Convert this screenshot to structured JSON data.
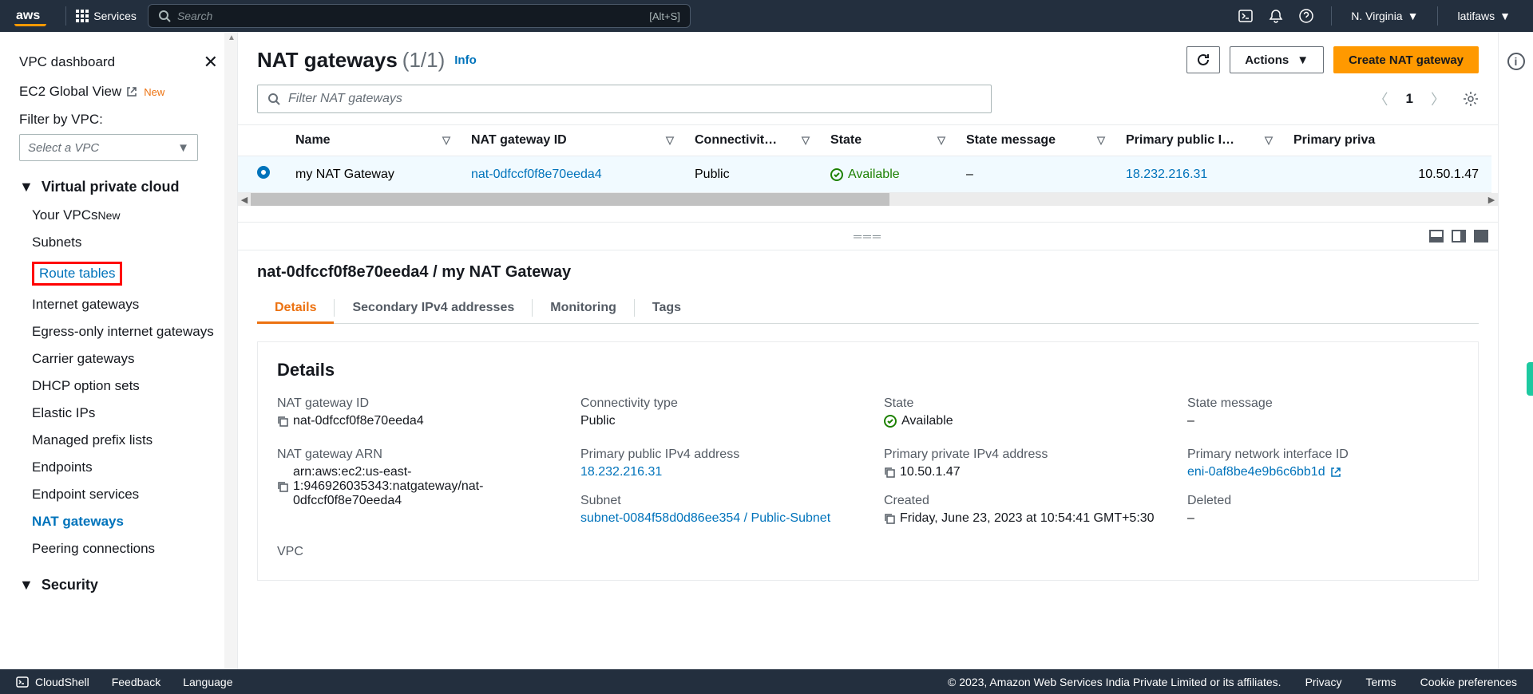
{
  "topnav": {
    "services": "Services",
    "search_placeholder": "Search",
    "search_shortcut": "[Alt+S]",
    "region": "N. Virginia",
    "user": "latifaws"
  },
  "sidebar": {
    "dashboard": "VPC dashboard",
    "global_view": "EC2 Global View",
    "badge_new": "New",
    "filter_label": "Filter by VPC:",
    "select_placeholder": "Select a VPC",
    "sections": {
      "vpc": {
        "title": "Virtual private cloud",
        "items": [
          "Your VPCs",
          "Subnets",
          "Route tables",
          "Internet gateways",
          "Egress-only internet gateways",
          "Carrier gateways",
          "DHCP option sets",
          "Elastic IPs",
          "Managed prefix lists",
          "Endpoints",
          "Endpoint services",
          "NAT gateways",
          "Peering connections"
        ]
      },
      "security": {
        "title": "Security"
      }
    }
  },
  "header": {
    "title": "NAT gateways",
    "count": "(1/1)",
    "info": "Info",
    "actions": "Actions",
    "create": "Create NAT gateway",
    "filter_placeholder": "Filter NAT gateways",
    "page": "1"
  },
  "table": {
    "cols": [
      "Name",
      "NAT gateway ID",
      "Connectivit…",
      "State",
      "State message",
      "Primary public I…",
      "Primary priva"
    ],
    "row": {
      "name": "my NAT Gateway",
      "id": "nat-0dfccf0f8e70eeda4",
      "connectivity": "Public",
      "state": "Available",
      "state_message": "–",
      "public_ip": "18.232.216.31",
      "private_ip": "10.50.1.47"
    }
  },
  "detail": {
    "breadcrumb": "nat-0dfccf0f8e70eeda4 / my NAT Gateway",
    "tabs": [
      "Details",
      "Secondary IPv4 addresses",
      "Monitoring",
      "Tags"
    ],
    "section_title": "Details",
    "fields": {
      "nat_id_label": "NAT gateway ID",
      "nat_id": "nat-0dfccf0f8e70eeda4",
      "conn_label": "Connectivity type",
      "conn": "Public",
      "state_label": "State",
      "state": "Available",
      "msg_label": "State message",
      "msg": "–",
      "arn_label": "NAT gateway ARN",
      "arn": "arn:aws:ec2:us-east-1:946926035343:natgateway/nat-0dfccf0f8e70eeda4",
      "pubip_label": "Primary public IPv4 address",
      "pubip": "18.232.216.31",
      "privip_label": "Primary private IPv4 address",
      "privip": "10.50.1.47",
      "eni_label": "Primary network interface ID",
      "eni": "eni-0af8be4e9b6c6bb1d",
      "subnet_label": "Subnet",
      "subnet": "subnet-0084f58d0d86ee354 / Public-Subnet",
      "created_label": "Created",
      "created": "Friday, June 23, 2023 at 10:54:41 GMT+5:30",
      "deleted_label": "Deleted",
      "deleted": "–",
      "vpc_label": "VPC"
    }
  },
  "footer": {
    "cloudshell": "CloudShell",
    "feedback": "Feedback",
    "language": "Language",
    "copyright": "© 2023, Amazon Web Services India Private Limited or its affiliates.",
    "privacy": "Privacy",
    "terms": "Terms",
    "cookies": "Cookie preferences"
  }
}
